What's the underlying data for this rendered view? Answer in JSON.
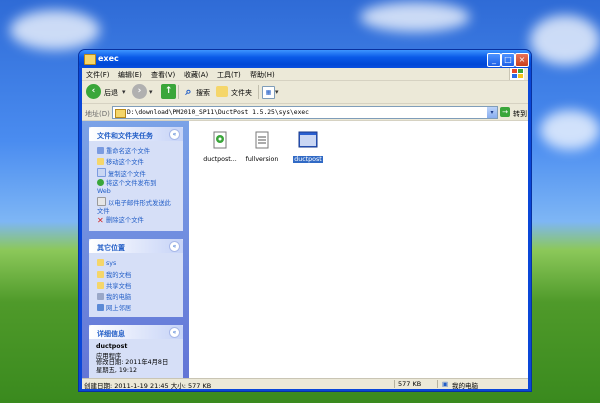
{
  "window": {
    "title": "exec"
  },
  "menu": [
    "文件(F)",
    "编辑(E)",
    "查看(V)",
    "收藏(A)",
    "工具(T)",
    "帮助(H)"
  ],
  "toolbar": {
    "back": "后退",
    "search": "搜索",
    "folders": "文件夹"
  },
  "address": {
    "label": "地址(D)",
    "path": "D:\\download\\PM2010_SP11\\DuctPost 1.5.25\\sys\\exec",
    "go": "转到"
  },
  "tasks_panel": {
    "title": "文件和文件夹任务",
    "items": [
      "重命名这个文件",
      "移动这个文件",
      "复制这个文件",
      "将这个文件发布到 Web",
      "以电子邮件形式发送此文件",
      "删除这个文件"
    ]
  },
  "places_panel": {
    "title": "其它位置",
    "items": [
      "sys",
      "我的文档",
      "共享文档",
      "我的电脑",
      "网上邻居"
    ]
  },
  "details_panel": {
    "title": "详细信息",
    "name": "ductpost",
    "type": "应用程序",
    "modified": "修改日期: 2011年4月8日 星期五, 19:12"
  },
  "files": [
    {
      "name": "ductpost...",
      "selected": false
    },
    {
      "name": "fullversion",
      "selected": false
    },
    {
      "name": "ductpost",
      "selected": true
    }
  ],
  "status": {
    "info": "创建日期: 2011-1-19 21:45 大小: 577 KB",
    "size": "577 KB",
    "location": "我的电脑"
  }
}
